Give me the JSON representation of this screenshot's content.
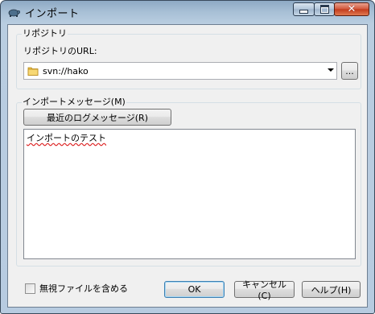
{
  "window": {
    "title": "インポート"
  },
  "titlebar": {
    "minimize_glyph": "",
    "maximize_glyph": "",
    "close_glyph": "✕"
  },
  "repository": {
    "group_label": "リポジトリ",
    "url_label": "リポジトリのURL:",
    "url_value": "svn://hako",
    "browse_button": "..."
  },
  "message": {
    "group_label": "インポートメッセージ(M)",
    "recent_button": "最近のログメッセージ(R)",
    "text": "インポートのテスト"
  },
  "footer": {
    "include_ignored_label": "無視ファイルを含める",
    "include_ignored_checked": false,
    "ok_button": "OK",
    "cancel_button": "キャンセル(C)",
    "help_button": "ヘルプ(H)"
  },
  "colors": {
    "title_bar": "#a8c0d6",
    "client_bg": "#f0f0f0",
    "close_button": "#c1391a",
    "spell_underline": "#dd2222"
  },
  "icons": {
    "app": "tortoise-icon",
    "folder": "folder-icon"
  }
}
